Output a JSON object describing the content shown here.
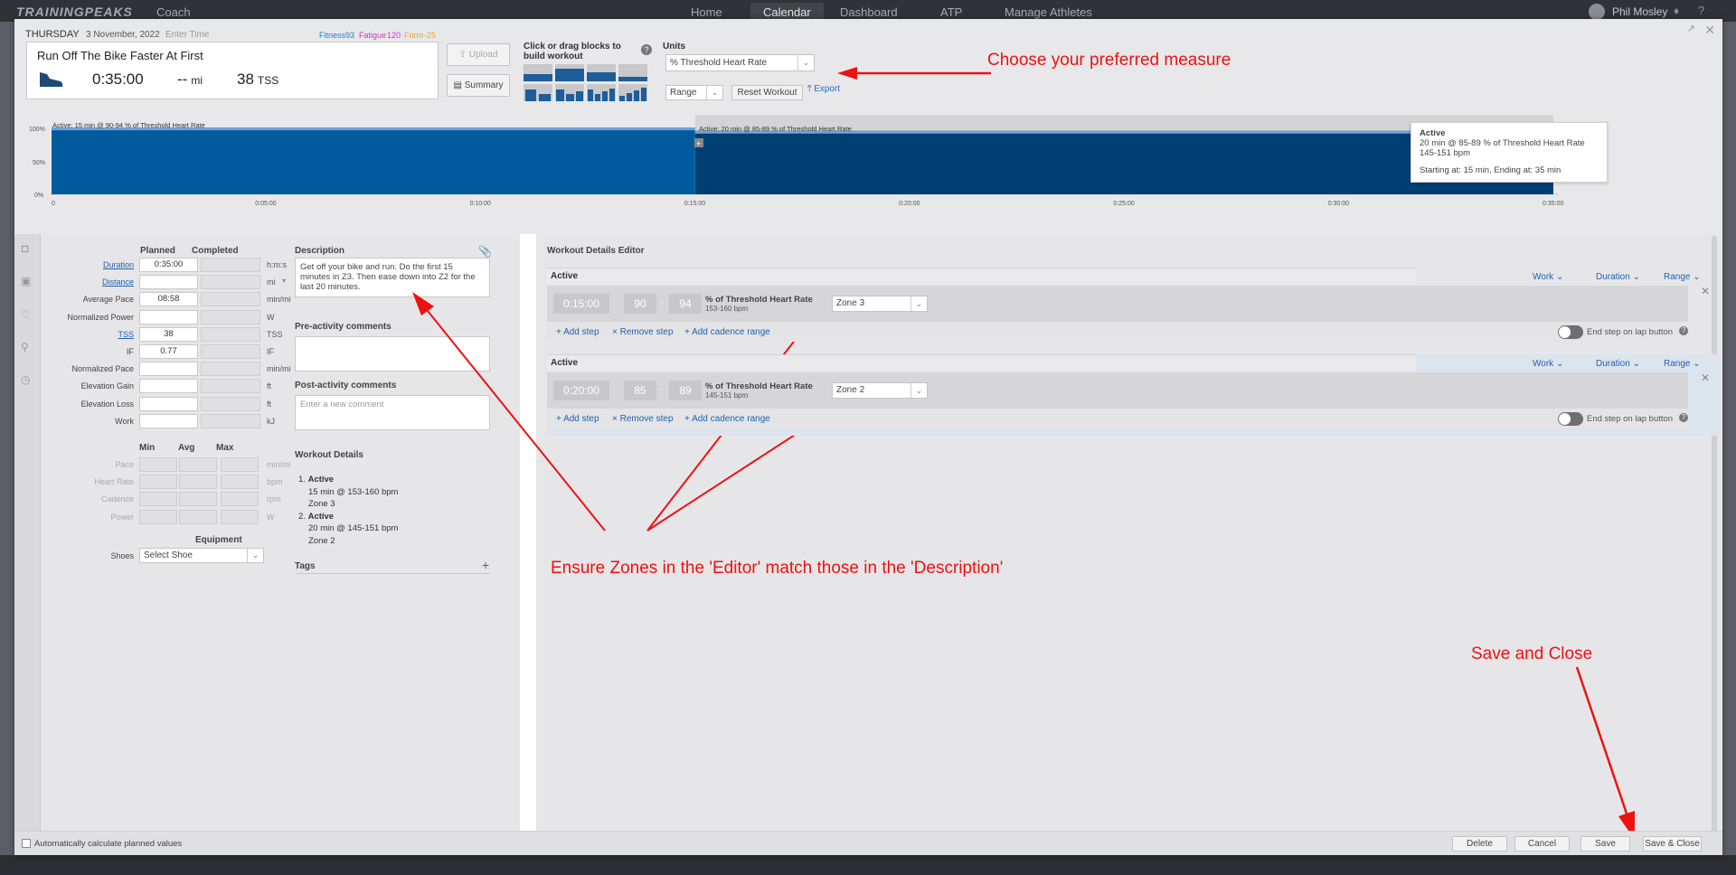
{
  "topbar": {
    "logo": "TRAININGPEAKS",
    "product": "Coach",
    "nav": [
      {
        "label": "Home",
        "active": false
      },
      {
        "label": "Calendar",
        "active": true
      },
      {
        "label": "Dashboard",
        "active": false
      },
      {
        "label": "ATP",
        "active": false
      },
      {
        "label": "Manage Athletes",
        "active": false
      }
    ],
    "user": "Phil Mosley"
  },
  "header": {
    "day": "THURSDAY",
    "date": "3 November, 2022",
    "time_placeholder": "Enter Time",
    "fitness_label": "Fitness",
    "fitness_value": "93",
    "fatigue_label": "Fatigue",
    "fatigue_value": "120",
    "form_label": "Form",
    "form_value": "-25",
    "workout_title": "Run Off The Bike Faster At First",
    "duration": "0:35:00",
    "distance": "--",
    "distance_unit": "mi",
    "tss": "38",
    "tss_unit": "TSS",
    "upload_label": "Upload",
    "summary_label": "Summary",
    "blocks_label": "Click or drag blocks to build workout",
    "units_label": "Units",
    "units_value": "% Threshold Heart Rate",
    "range_value": "Range",
    "reset_label": "Reset Workout",
    "export_label": "Export"
  },
  "colors": {
    "primary_blue": "#0a5aa0",
    "dark_blue": "#003f74",
    "link_blue": "#1f61b0",
    "fitness": "#2a7ad2",
    "fatigue": "#d62fd4",
    "form": "#f2a02a",
    "annotation_red": "#ee1111"
  },
  "graph": {
    "y_ticks": [
      "100%",
      "50%",
      "0%"
    ],
    "x_ticks": [
      "0",
      "0:05:00",
      "0:10:00",
      "0:15:00",
      "0:20:00",
      "0:25:00",
      "0:30:00",
      "0:35:00"
    ],
    "seg1_label": "Active: 15 min @ 90-94 % of Threshold Heart Rate",
    "seg2_label": "Active: 20 min @ 85-89 % of Threshold Heart Rate",
    "segments": [
      {
        "start_min": 0,
        "end_min": 15,
        "low_pct": 90,
        "high_pct": 94
      },
      {
        "start_min": 15,
        "end_min": 35,
        "low_pct": 85,
        "high_pct": 89
      }
    ],
    "total_min": 35,
    "plus": "+"
  },
  "tooltip": {
    "title": "Active",
    "line1": "20 min @ 85-89 % of Threshold Heart Rate",
    "line2": "145-151 bpm",
    "line3": "Starting at: 15 min, Ending at: 35 min"
  },
  "summary": {
    "planned_header": "Planned",
    "completed_header": "Completed",
    "rows": [
      {
        "label": "Duration",
        "planned": "0:35:00",
        "unit": "h:m:s",
        "link": true
      },
      {
        "label": "Distance",
        "planned": "",
        "unit": "mi",
        "link": true
      },
      {
        "label": "Average Pace",
        "planned": "08:58",
        "unit": "min/mi",
        "link": false
      },
      {
        "label": "Normalized Power",
        "planned": "",
        "unit": "W",
        "link": false
      },
      {
        "label": "TSS",
        "planned": "38",
        "unit": "TSS",
        "link": true
      },
      {
        "label": "IF",
        "planned": "0.77",
        "unit": "IF",
        "link": false
      },
      {
        "label": "Normalized Pace",
        "planned": "",
        "unit": "min/mi",
        "link": false
      },
      {
        "label": "Elevation Gain",
        "planned": "",
        "unit": "ft",
        "link": false
      },
      {
        "label": "Elevation Loss",
        "planned": "",
        "unit": "ft",
        "link": false
      },
      {
        "label": "Work",
        "planned": "",
        "unit": "kJ",
        "link": false
      }
    ],
    "mma_headers": [
      "Min",
      "Avg",
      "Max"
    ],
    "mma_rows": [
      {
        "label": "Pace",
        "unit": "min/mi"
      },
      {
        "label": "Heart Rate",
        "unit": "bpm"
      },
      {
        "label": "Cadence",
        "unit": "rpm"
      },
      {
        "label": "Power",
        "unit": "W"
      }
    ],
    "equipment_header": "Equipment",
    "shoes_label": "Shoes",
    "shoes_value": "Select Shoe"
  },
  "description": {
    "header": "Description",
    "text": "Get off your bike and run. Do the first 15 minutes in Z3. Then ease down into Z2 for the last 20 minutes.",
    "pre_header": "Pre-activity comments",
    "post_header": "Post-activity comments",
    "post_placeholder": "Enter a new comment",
    "details_header": "Workout Details",
    "details": [
      {
        "num": "1.",
        "title": "Active",
        "line1": "15 min @ 153-160 bpm",
        "line2": "Zone 3"
      },
      {
        "num": "2.",
        "title": "Active",
        "line1": "20 min @ 145-151 bpm",
        "line2": "Zone 2"
      }
    ],
    "tags_header": "Tags",
    "tags_plus": "+"
  },
  "editor": {
    "header": "Workout Details Editor",
    "steps": [
      {
        "name": "Active",
        "duration": "0:15:00",
        "low": "90",
        "high": "94",
        "metric": "% of Threshold Heart Rate",
        "bpm": "153-160 bpm",
        "zone": "Zone 3"
      },
      {
        "name": "Active",
        "duration": "0:20:00",
        "low": "85",
        "high": "89",
        "metric": "% of Threshold Heart Rate",
        "bpm": "145-151 bpm",
        "zone": "Zone 2"
      }
    ],
    "dd_work": "Work",
    "dd_duration": "Duration",
    "dd_range": "Range",
    "add_step": "Add step",
    "remove_step": "Remove step",
    "add_cadence": "Add cadence range",
    "lap_label": "End step on lap button",
    "dash": "-"
  },
  "footer": {
    "auto_calc": "Automatically calculate planned values",
    "delete": "Delete",
    "cancel": "Cancel",
    "save": "Save",
    "save_close": "Save & Close"
  },
  "annotations": {
    "measure": "Choose your preferred measure",
    "zones": "Ensure Zones in the 'Editor' match those in the 'Description'",
    "save_close": "Save and Close"
  }
}
